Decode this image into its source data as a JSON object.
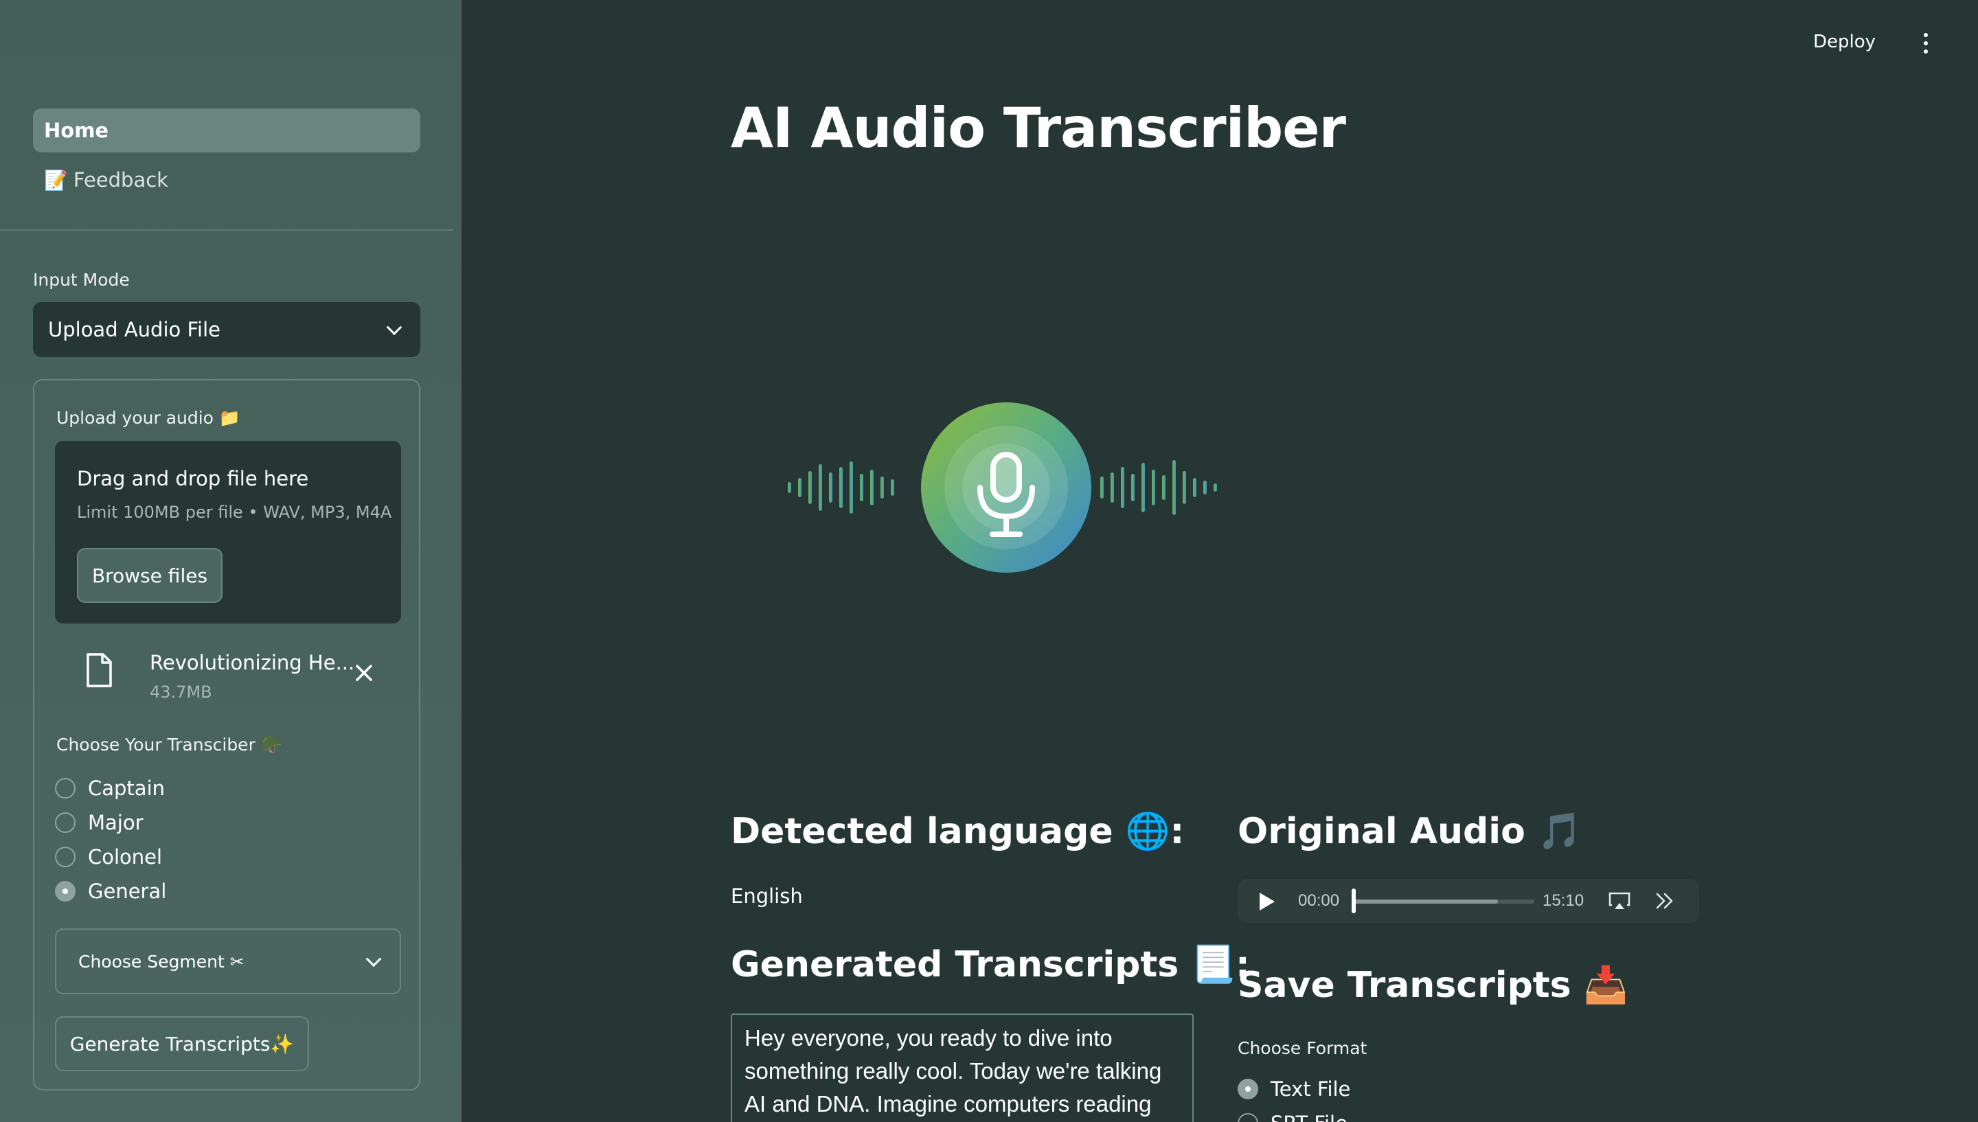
{
  "sidebar": {
    "nav": [
      {
        "label": "Home",
        "active": true
      },
      {
        "label": "Feedback",
        "emoji": "📝"
      }
    ],
    "input_mode": {
      "label": "Input Mode",
      "selected": "Upload Audio File"
    },
    "upload": {
      "label": "Upload your audio 📁",
      "drop_title": "Drag and drop file here",
      "drop_limit": "Limit 100MB per file • WAV, MP3, M4A",
      "browse_label": "Browse files",
      "file": {
        "name": "Revolutionizing He...",
        "size": "43.7MB"
      }
    },
    "transcriber": {
      "label": "Choose Your Transciber 🪖",
      "options": [
        "Captain",
        "Major",
        "Colonel",
        "General"
      ],
      "selected": "General"
    },
    "segment": {
      "label": "Choose Segment ✂"
    },
    "generate_label": "Generate Transcripts✨"
  },
  "header": {
    "deploy_label": "Deploy"
  },
  "main": {
    "title": "AI Audio Transcriber",
    "detected": {
      "heading": "Detected language 🌐:",
      "value": "English"
    },
    "generated": {
      "heading": "Generated Transcripts 📃:",
      "text": "Hey everyone, you ready to dive into something really cool. Today we're talking AI and DNA. Imagine computers reading your"
    },
    "original_audio": {
      "heading": "Original Audio 🎵",
      "current_time": "00:00",
      "duration": "15:10",
      "buffered": 0.8
    },
    "save": {
      "heading": "Save Transcripts 📥",
      "format_label": "Choose Format",
      "options": [
        "Text File",
        "SRT File"
      ],
      "selected": "Text File"
    }
  },
  "colors": {
    "background": "#263634",
    "sidebar": "#445f58",
    "accent_green": "#8bbf4a",
    "accent_blue": "#4a90c8"
  }
}
